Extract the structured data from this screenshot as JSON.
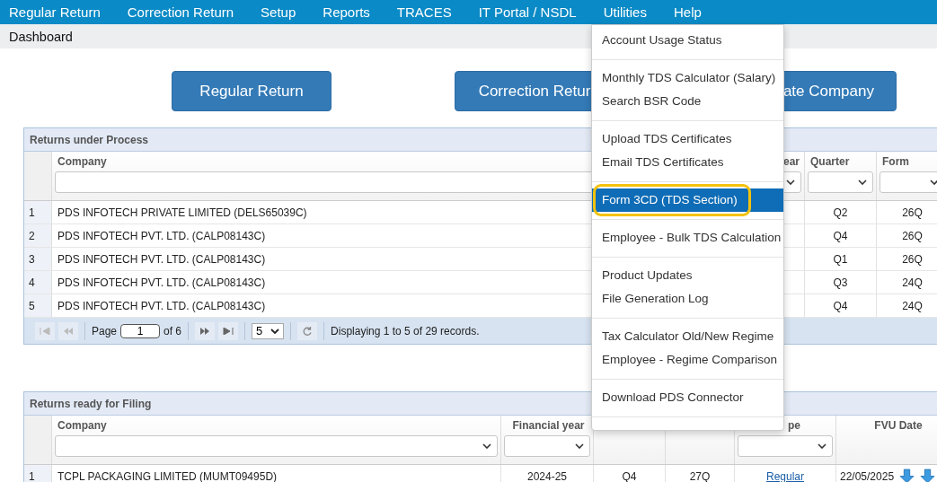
{
  "nav": [
    {
      "label": "Regular Return"
    },
    {
      "label": "Correction Return"
    },
    {
      "label": "Setup"
    },
    {
      "label": "Reports"
    },
    {
      "label": "TRACES"
    },
    {
      "label": "IT Portal / NSDL"
    },
    {
      "label": "Utilities"
    },
    {
      "label": "Help"
    }
  ],
  "breadcrumb": "Dashboard",
  "actions": [
    "Regular Return",
    "Correction Retur",
    "ate Company"
  ],
  "process_table": {
    "title": "Returns under Process",
    "columns": [
      {
        "label": "Company",
        "kind": "text"
      },
      {
        "label": "ear",
        "kind": "select"
      },
      {
        "label": "Quarter",
        "kind": "select"
      },
      {
        "label": "Form",
        "kind": "select"
      }
    ],
    "rows": [
      {
        "number": "1",
        "company": "PDS INFOTECH PRIVATE LIMITED (DELS65039C)",
        "quarter": "Q2",
        "form": "26Q"
      },
      {
        "number": "2",
        "company": "PDS INFOTECH PVT. LTD. (CALP08143C)",
        "quarter": "Q4",
        "form": "26Q"
      },
      {
        "number": "3",
        "company": "PDS INFOTECH PVT. LTD. (CALP08143C)",
        "quarter": "Q1",
        "form": "26Q"
      },
      {
        "number": "4",
        "company": "PDS INFOTECH PVT. LTD. (CALP08143C)",
        "quarter": "Q3",
        "form": "24Q"
      },
      {
        "number": "5",
        "company": "PDS INFOTECH PVT. LTD. (CALP08143C)",
        "quarter": "Q4",
        "form": "24Q"
      }
    ],
    "pager": {
      "page_label": "Page",
      "page": "1",
      "of": "of 6",
      "page_size": "5",
      "status": "Displaying 1 to 5 of 29 records."
    }
  },
  "filing_table": {
    "title": "Returns ready for Filing",
    "columns": [
      {
        "label": "Company",
        "kind": "select"
      },
      {
        "label": "Financial year",
        "kind": "select"
      },
      {
        "label": "pe",
        "kind": "select"
      },
      {
        "label": "FVU Date",
        "kind": "plain"
      }
    ],
    "rows": [
      {
        "number": "1",
        "company": "TCPL PACKAGING LIMITED (MUMT09495D)",
        "year": "2024-25",
        "quarter": "Q4",
        "form": "27Q",
        "type": "Regular",
        "fvu_date": "22/05/2025"
      }
    ]
  },
  "menu": {
    "groups": [
      [
        {
          "label": "Account Usage Status",
          "selected": false
        }
      ],
      [
        {
          "label": "Monthly TDS Calculator (Salary)",
          "selected": false
        },
        {
          "label": "Search BSR Code",
          "selected": false
        }
      ],
      [
        {
          "label": "Upload TDS Certificates",
          "selected": false
        },
        {
          "label": "Email TDS Certificates",
          "selected": false
        }
      ],
      [
        {
          "label": "Form 3CD (TDS Section)",
          "selected": true
        }
      ],
      [
        {
          "label": "Employee - Bulk TDS Calculation",
          "selected": false
        }
      ],
      [
        {
          "label": "Product Updates",
          "selected": false
        },
        {
          "label": "File Generation Log",
          "selected": false
        }
      ],
      [
        {
          "label": "Tax Calculator Old/New Regime",
          "selected": false
        },
        {
          "label": "Employee - Regime Comparison",
          "selected": false
        }
      ],
      [
        {
          "label": "Download PDS Connector",
          "selected": false
        }
      ]
    ]
  }
}
